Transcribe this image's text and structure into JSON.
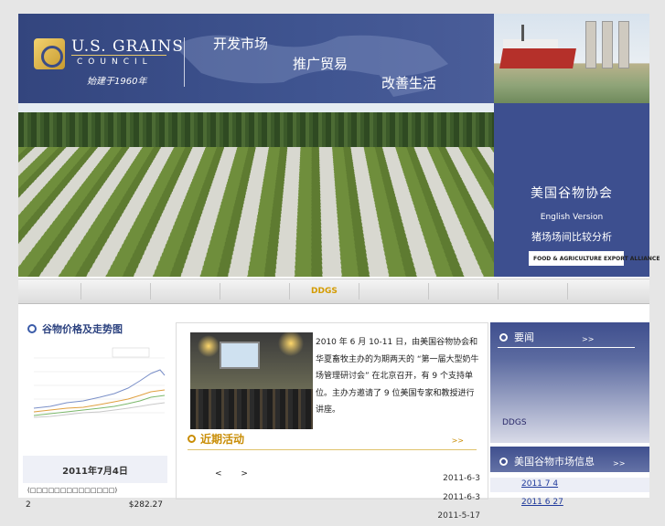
{
  "header": {
    "logo_title": "U.S. GRAINS",
    "logo_subtitle": "COUNCIL",
    "logo_since": "始建于1960年",
    "slogans": [
      "开发市场",
      "推广贸易",
      "改善生活"
    ]
  },
  "side_panel": {
    "title": "美国谷物协会",
    "english_link": "English Version",
    "pig_link": "猪场场间比较分析",
    "partner_logo_text": "FOOD & AGRICULTURE EXPORT ALLIANCE"
  },
  "nav": {
    "active_item": "DDGS"
  },
  "price_trend": {
    "title": "谷物价格及走势图",
    "date": "2011年7月4日",
    "table_header": "(□□□□□□□□□□□□□□)",
    "row_index": "2",
    "row_value": "$282.27"
  },
  "news": {
    "paragraph": "2010 年 6 月 10-11 日，由美国谷物协会和华夏畜牧主办的为期两天的 “第一届大型奶牛场管理研讨会” 在北京召开，有 9 个支持单位。主办方邀请了 9 位美国专家和教授进行讲座。",
    "recent_title": "近期活动",
    "more": ">>",
    "prev": "<",
    "next": ">",
    "dates": [
      "2011-6-3",
      "2011-6-3",
      "2011-5-17"
    ]
  },
  "right_col": {
    "headlines_title": "要闻",
    "headlines_more": ">>",
    "headline_item": "DDGS",
    "market_title": "美国谷物市场信息",
    "market_more": ">>",
    "market_links": [
      "2011 7 4",
      "2011 6 27"
    ]
  }
}
